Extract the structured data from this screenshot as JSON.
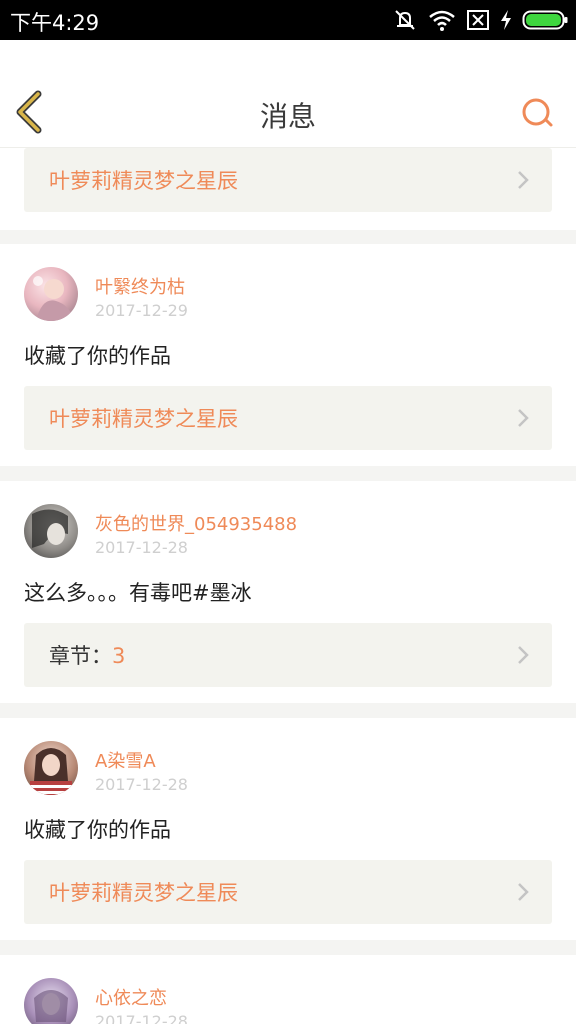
{
  "status_bar": {
    "time": "下午4:29"
  },
  "header": {
    "title": "消息"
  },
  "messages": [
    {
      "ref_title": "叶萝莉精灵梦之星辰"
    },
    {
      "user": "叶繄终为枯",
      "date": "2017-12-29",
      "text": "收藏了你的作品",
      "ref_title": "叶萝莉精灵梦之星辰"
    },
    {
      "user": "灰色的世界_054935488",
      "date": "2017-12-28",
      "text": "这么多。。。有毒吧#墨冰",
      "ref_label": "章节：",
      "ref_value": "3"
    },
    {
      "user": "A染雪A",
      "date": "2017-12-28",
      "text": "收藏了你的作品",
      "ref_title": "叶萝莉精灵梦之星辰"
    },
    {
      "user": "心依之恋",
      "date": "2017-12-28"
    }
  ],
  "colors": {
    "accent": "#ef8a58",
    "back_arrow": "#d9b64a",
    "ref_bg": "#f3f3ee"
  },
  "icons": {
    "back": "back-arrow-icon",
    "search": "search-icon",
    "chevron": "chevron-right-icon"
  }
}
